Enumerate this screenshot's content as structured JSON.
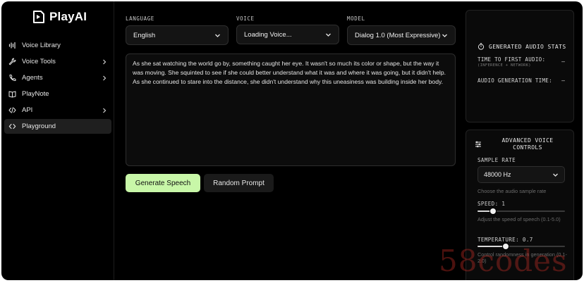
{
  "brand": {
    "name": "PlayAI"
  },
  "sidebar": {
    "items": [
      {
        "label": "Voice Library",
        "icon": "waveform-icon",
        "chevron": false,
        "active": false
      },
      {
        "label": "Voice Tools",
        "icon": "wrench-icon",
        "chevron": true,
        "active": false
      },
      {
        "label": "Agents",
        "icon": "phone-icon",
        "chevron": true,
        "active": false
      },
      {
        "label": "PlayNote",
        "icon": "book-icon",
        "chevron": false,
        "active": false
      },
      {
        "label": "API",
        "icon": "code-icon",
        "chevron": true,
        "active": false
      },
      {
        "label": "Playground",
        "icon": "brackets-icon",
        "chevron": false,
        "active": true
      }
    ]
  },
  "main": {
    "language": {
      "label": "LANGUAGE",
      "value": "English"
    },
    "voice": {
      "label": "VOICE",
      "value": "Loading Voice..."
    },
    "model": {
      "label": "MODEL",
      "value": "Dialog 1.0 (Most Expressive)"
    },
    "prompt_text": "As she sat watching the world go by, something caught her eye. It wasn't so much its color or shape, but the way it was moving. She squinted to see if she could better understand what it was and where it was going, but it didn't help. As she continued to stare into the distance, she didn't understand why this uneasiness was building inside her body.",
    "generate_label": "Generate Speech",
    "random_label": "Random Prompt"
  },
  "stats": {
    "title": "GENERATED AUDIO STATS",
    "ttfa_label": "TIME TO FIRST AUDIO:",
    "ttfa_sub": "(INFERENCE + NETWORK)",
    "ttfa_value": "—",
    "gen_label": "AUDIO GENERATION TIME:",
    "gen_value": "—"
  },
  "advanced": {
    "title_line1": "ADVANCED VOICE",
    "title_line2": "CONTROLS",
    "sample_rate_label": "SAMPLE RATE",
    "sample_rate_value": "48000 Hz",
    "sample_rate_help": "Choose the audio sample rate",
    "speed_label": "SPEED: 1",
    "speed_help": "Adjust the speed of speech (0.1-5.0)",
    "speed_fraction": 0.18,
    "temperature_label": "TEMPERATURE: 0.7",
    "temperature_help": "Control randomness in generation (0.1-2.0)",
    "temperature_fraction": 0.32
  },
  "watermark": "58codes",
  "colors": {
    "accent": "#c8f7a8",
    "background": "#000000",
    "panel": "#0a0a0a",
    "border": "#2e2e2e"
  }
}
